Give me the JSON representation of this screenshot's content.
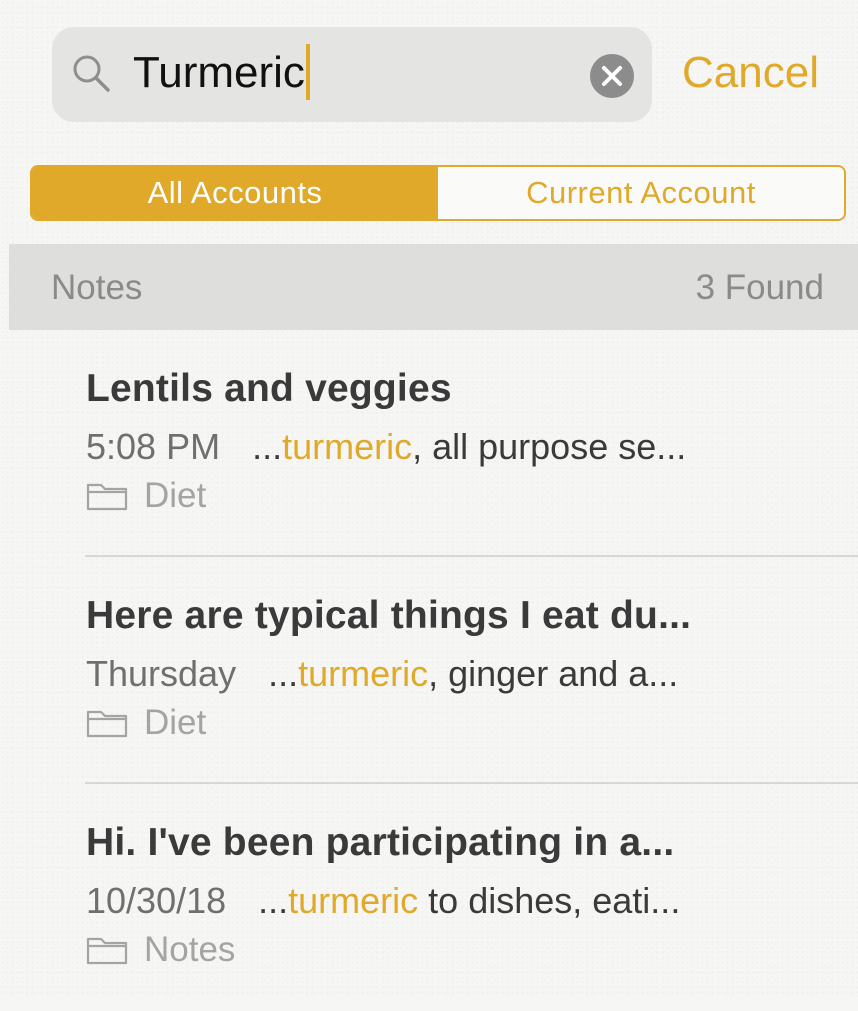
{
  "search": {
    "query": "Turmeric",
    "cancel_label": "Cancel"
  },
  "scope": {
    "options": [
      "All Accounts",
      "Current Account"
    ],
    "selected": "All Accounts"
  },
  "section": {
    "title": "Notes",
    "count": "3 Found"
  },
  "results": [
    {
      "title": "Lentils and veggies",
      "date": "5:08 PM",
      "snippet_prefix": "...",
      "snippet_match": "turmeric",
      "snippet_suffix": ", all purpose se...",
      "folder": "Diet"
    },
    {
      "title": "Here are typical things I eat du...",
      "date": "Thursday",
      "snippet_prefix": "...",
      "snippet_match": "turmeric",
      "snippet_suffix": ", ginger and a...",
      "folder": "Diet"
    },
    {
      "title": "Hi. I've been participating in a...",
      "date": "10/30/18",
      "snippet_prefix": "...",
      "snippet_match": "turmeric",
      "snippet_suffix": " to dishes, eati...",
      "folder": "Notes"
    }
  ],
  "colors": {
    "accent": "#e0a92a",
    "search_field_bg": "#e4e4e2",
    "section_header_bg": "#dededc"
  },
  "icons": {
    "search": "search-icon",
    "clear": "clear-icon",
    "folder": "folder-icon"
  }
}
